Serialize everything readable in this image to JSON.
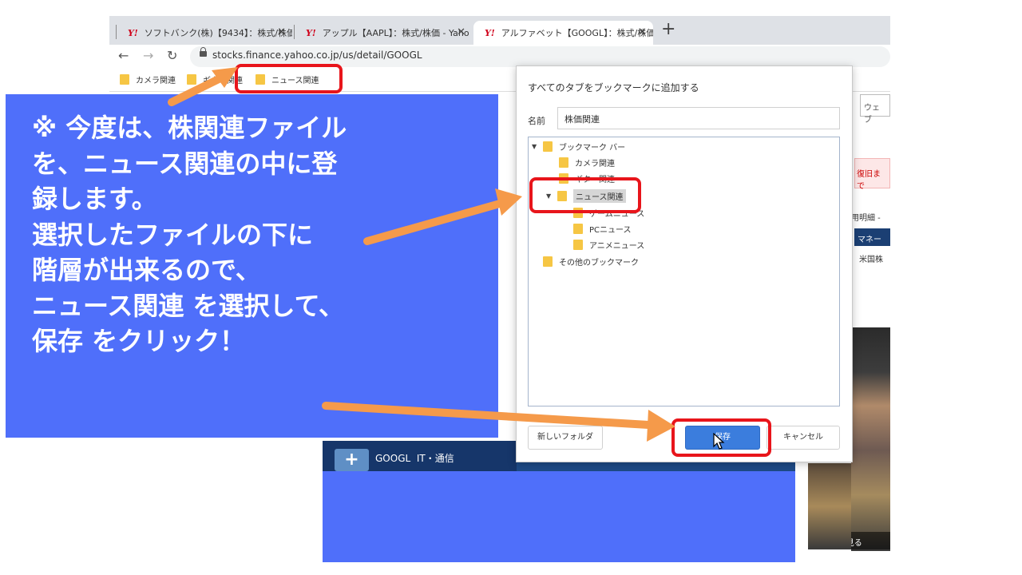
{
  "browser": {
    "tabs": [
      {
        "label": "ソフトバンク(株)【9434】：株式/株価",
        "active": false
      },
      {
        "label": "アップル【AAPL】：株式/株価 - Yaho",
        "active": false
      },
      {
        "label": "アルファベット【GOOGL】：株式/株価",
        "active": true
      }
    ],
    "tab_logo": "Y!",
    "close_glyph": "✕",
    "new_tab_glyph": "+",
    "url": "stocks.finance.yahoo.co.jp/us/detail/GOOGL",
    "bookmarks": [
      {
        "label": "カメラ関連"
      },
      {
        "label": "ギター関連"
      },
      {
        "label": "ニュース関連"
      }
    ]
  },
  "page": {
    "search_placeholder": "ウェブ",
    "pink_notice": "復旧まで",
    "detail_link": "用明細 -",
    "navy_tab": "マネー",
    "us_stocks": "米国株",
    "ticker": "GOOGL",
    "sector": "IT・通信",
    "ad_caption": "もう一度見る"
  },
  "dialog": {
    "title": "すべてのタブをブックマークに追加する",
    "name_label": "名前",
    "name_value": "株価関連",
    "tree": [
      {
        "label": "ブックマーク バー",
        "expanded": true,
        "selected": false
      },
      {
        "label": "カメラ関連",
        "expanded": null,
        "selected": false
      },
      {
        "label": "ギター関連",
        "expanded": null,
        "selected": false
      },
      {
        "label": "ニュース関連",
        "expanded": true,
        "selected": true
      },
      {
        "label": "ゲームニュース",
        "expanded": null,
        "selected": false
      },
      {
        "label": "PCニュース",
        "expanded": null,
        "selected": false
      },
      {
        "label": "アニメニュース",
        "expanded": null,
        "selected": false
      },
      {
        "label": "その他のブックマーク",
        "expanded": null,
        "selected": false
      }
    ],
    "new_folder_label": "新しいフォルダ",
    "save_label": "保存",
    "cancel_label": "キャンセル"
  },
  "annotation": {
    "text": "※ 今度は、株関連ファイル\nを、ニュース関連の中に登\n録します。\n選択したファイルの下に\n階層が出来るので、\nニュース関連 を選択して、\n保存 をクリック！"
  },
  "colors": {
    "annotation_bg": "#4f6ffa",
    "highlight_red": "#e8151b",
    "arrow_orange": "#f59a4a",
    "folder_yellow": "#f6c644",
    "save_blue": "#3b7ddd"
  },
  "icons": [
    "back-arrow-icon",
    "forward-arrow-icon",
    "reload-icon",
    "lock-icon",
    "folder-icon",
    "expand-triangle-icon",
    "mouse-cursor-icon"
  ]
}
